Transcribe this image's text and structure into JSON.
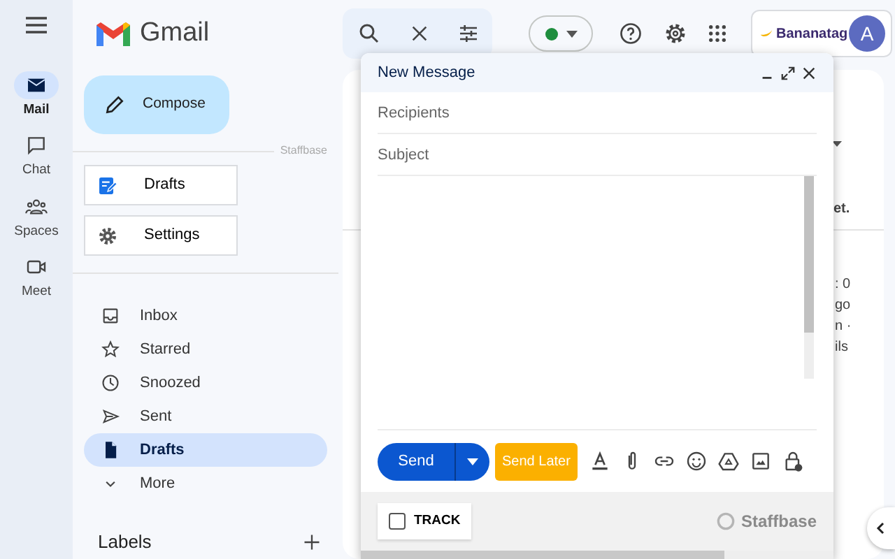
{
  "rail": [
    {
      "kind": "mail",
      "label": "Mail",
      "selected": true
    },
    {
      "kind": "chat",
      "label": "Chat",
      "selected": false
    },
    {
      "kind": "spaces",
      "label": "Spaces",
      "selected": false
    },
    {
      "kind": "meet",
      "label": "Meet",
      "selected": false
    }
  ],
  "brand": "Gmail",
  "extension": {
    "name": "Bananatag",
    "avatar": "A"
  },
  "compose_button": "Compose",
  "divider_label": "Staffbase",
  "shortcuts": [
    {
      "kind": "drafts",
      "label": "Drafts"
    },
    {
      "kind": "settings",
      "label": "Settings"
    }
  ],
  "folders": [
    {
      "kind": "inbox",
      "label": "Inbox",
      "selected": false
    },
    {
      "kind": "starred",
      "label": "Starred",
      "selected": false
    },
    {
      "kind": "snoozed",
      "label": "Snoozed",
      "selected": false
    },
    {
      "kind": "sent",
      "label": "Sent",
      "selected": false
    },
    {
      "kind": "drafts",
      "label": "Drafts",
      "selected": true
    },
    {
      "kind": "more",
      "label": "More",
      "selected": false
    }
  ],
  "labels_heading": "Labels",
  "background": {
    "right_fragment": "et.",
    "side_fragments": [
      ": 0",
      "go",
      "n ·",
      "ils"
    ]
  },
  "compose": {
    "title": "New Message",
    "recipients_placeholder": "Recipients",
    "subject_placeholder": "Subject",
    "send": "Send",
    "send_later": "Send Later",
    "track": {
      "label": "TRACK",
      "checked": false
    },
    "footer_brand": "Staffbase"
  }
}
